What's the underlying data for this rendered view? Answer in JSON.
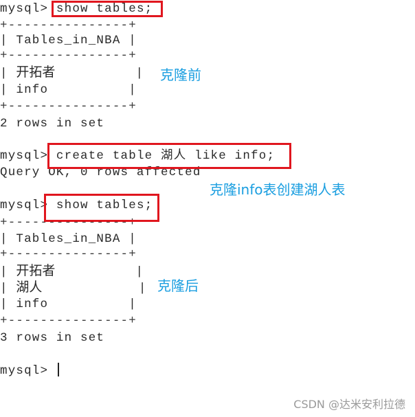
{
  "terminal": {
    "prompt": "mysql>",
    "block1": {
      "command": "show tables;",
      "border": "+---------------+",
      "header": "| Tables_in_NBA |",
      "rows": [
        "开拓者",
        "info"
      ],
      "footer": "2 rows in set"
    },
    "block2": {
      "command": "create table 湖人 like info;",
      "result": "Query OK, 0 rows affected"
    },
    "block3": {
      "command": "show tables;",
      "border": "+---------------+",
      "header": "| Tables_in_NBA |",
      "rows": [
        "开拓者",
        "湖人",
        "info"
      ],
      "footer": "3 rows in set"
    },
    "final_prompt": "mysql>"
  },
  "annotations": {
    "before_clone": "克隆前",
    "clone_action": "克隆info表创建湖人表",
    "after_clone": "克隆后"
  },
  "watermark": "CSDN @达米安利拉德",
  "colors": {
    "highlight_box": "#e0161e",
    "annotation": "#1a9ee0"
  }
}
